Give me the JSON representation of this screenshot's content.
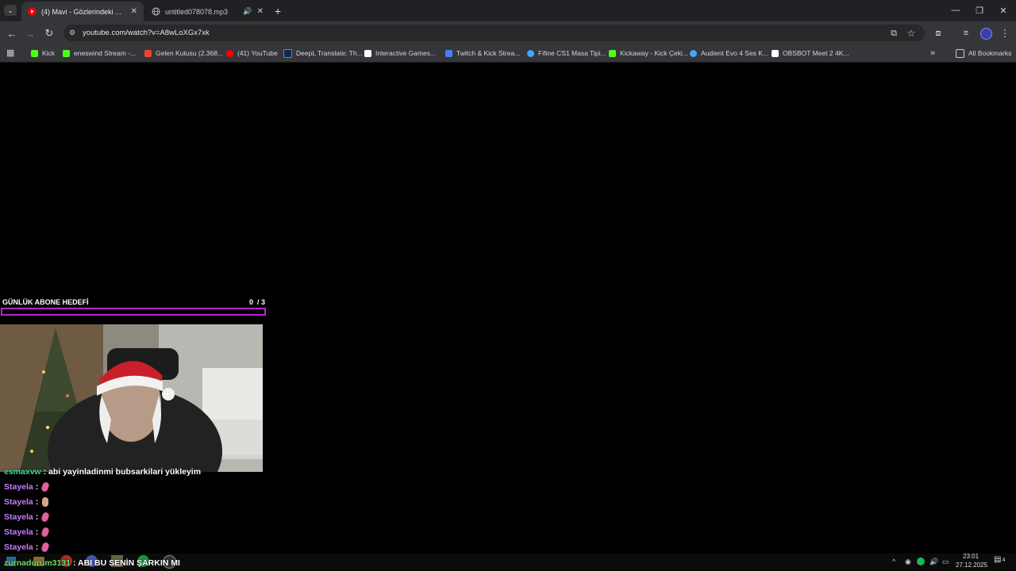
{
  "browser": {
    "tabs": [
      {
        "title": "(4) Mavi - Gözlerindeki Ay (Aku",
        "active": true
      },
      {
        "title": "untitled078078.mp3",
        "active": false
      }
    ],
    "new_tab_label": "+",
    "url": "youtube.com/watch?v=A8wLoXGx7xk",
    "bookmarks": [
      {
        "label": "Kick",
        "color": "#53fc18"
      },
      {
        "label": "eneswind Stream -...",
        "color": "#53fc18"
      },
      {
        "label": "Gelen Kutusu (2.368...",
        "color": "#ea4335"
      },
      {
        "label": "(41) YouTube",
        "color": "#ff0000"
      },
      {
        "label": "DeepL Translate: Th...",
        "color": "#0f2b46"
      },
      {
        "label": "Interactive Games...",
        "color": "#ffffff"
      },
      {
        "label": "Twitch & Kick Strea...",
        "color": "#4a7dff"
      },
      {
        "label": "Fifine CS1 Masa Tipi...",
        "color": "#4aa3ff"
      },
      {
        "label": "Kickaway - Kick Çeki...",
        "color": "#53fc18"
      },
      {
        "label": "Audient Evo 4 Ses K...",
        "color": "#4aa3ff"
      },
      {
        "label": "OBSBOT Meet 2 4K...",
        "color": "#ffffff"
      }
    ],
    "all_bookmarks_label": "All Bookmarks"
  },
  "overlay": {
    "goal_title": "GÜNLÜK ABONE HEDEFİ",
    "goal_count": "0  / 3",
    "goal_progress": 0,
    "accent_color": "#b427c8",
    "chat": [
      {
        "user": "esmaxvw",
        "sep": " : ",
        "message": "abi yayinladinmi bubsarkilari yükleyim"
      },
      {
        "user": "Stayela",
        "sep": " : ",
        "message": ""
      },
      {
        "user": "Stayela",
        "sep": " : ",
        "message": ""
      },
      {
        "user": "Stayela",
        "sep": " : ",
        "message": ""
      },
      {
        "user": "Stayela",
        "sep": " : ",
        "message": ""
      },
      {
        "user": "Stayela",
        "sep": " : ",
        "message": ""
      },
      {
        "user": "zurnadurum3131",
        "sep": " : ",
        "message": "ABI BU SENİN ŞARKIN MI"
      }
    ]
  },
  "taskbar": {
    "time": "23:01",
    "date": "27.12.2025",
    "notification_count": "4"
  }
}
